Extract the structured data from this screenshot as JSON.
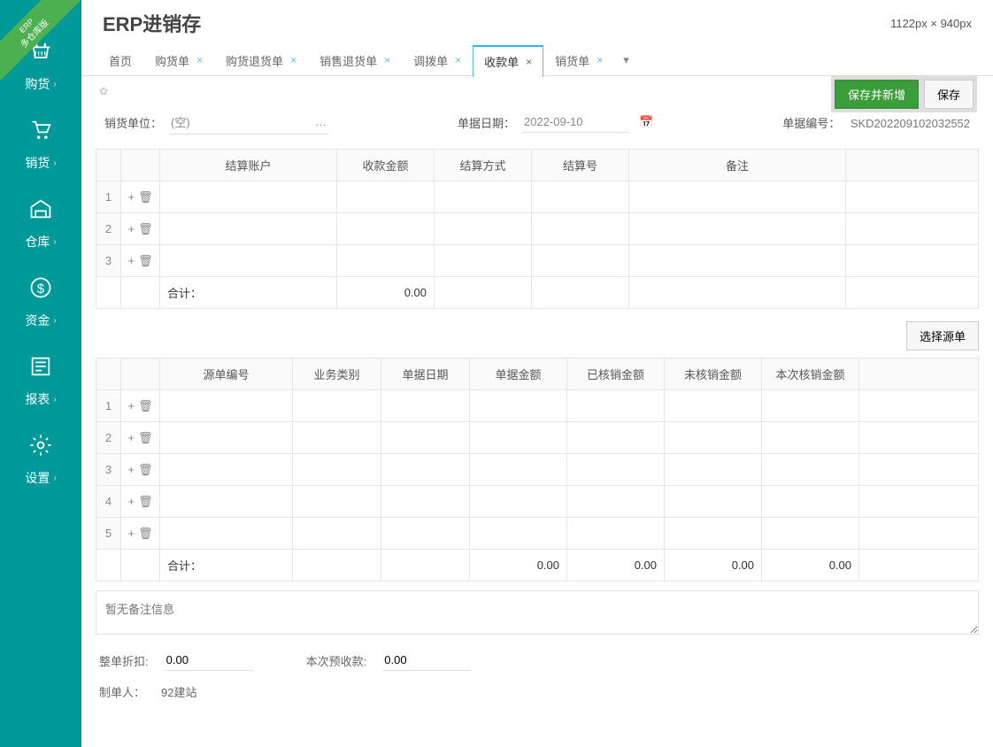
{
  "ribbon": {
    "line1": "ERP",
    "line2": "多仓库版"
  },
  "header": {
    "title": "ERP进销存",
    "dimensions": "1122px × 940px"
  },
  "sidebar": {
    "items": [
      {
        "label": "购货",
        "icon": "basket"
      },
      {
        "label": "销货",
        "icon": "cart"
      },
      {
        "label": "仓库",
        "icon": "warehouse"
      },
      {
        "label": "资金",
        "icon": "money"
      },
      {
        "label": "报表",
        "icon": "report"
      },
      {
        "label": "设置",
        "icon": "gear"
      }
    ]
  },
  "tabs": {
    "items": [
      {
        "label": "首页",
        "closable": false
      },
      {
        "label": "购货单",
        "closable": true
      },
      {
        "label": "购货退货单",
        "closable": true
      },
      {
        "label": "销售退货单",
        "closable": true
      },
      {
        "label": "调拨单",
        "closable": true
      },
      {
        "label": "收款单",
        "closable": true,
        "active": true
      },
      {
        "label": "销货单",
        "closable": true
      }
    ]
  },
  "actions": {
    "saveAdd": "保存并新增",
    "save": "保存"
  },
  "form": {
    "unitLabel": "销货单位：",
    "unitValue": "(空)",
    "dateLabel": "单据日期：",
    "dateValue": "2022-09-10",
    "docNoLabel": "单据编号：",
    "docNoValue": "SKD202209102032552"
  },
  "table1": {
    "headers": [
      "结算账户",
      "收款金额",
      "结算方式",
      "结算号",
      "备注"
    ],
    "rows": [
      1,
      2,
      3
    ],
    "totalLabel": "合计：",
    "totalAmount": "0.00"
  },
  "sourceBtn": "选择源单",
  "table2": {
    "headers": [
      "源单编号",
      "业务类别",
      "单据日期",
      "单据金额",
      "已核销金额",
      "未核销金额",
      "本次核销金额"
    ],
    "rows": [
      1,
      2,
      3,
      4,
      5
    ],
    "totalLabel": "合计：",
    "totals": [
      "0.00",
      "0.00",
      "0.00",
      "0.00"
    ]
  },
  "remark": {
    "placeholder": "暂无备注信息"
  },
  "footer": {
    "discountLabel": "整单折扣:",
    "discountValue": "0.00",
    "prepayLabel": "本次预收款:",
    "prepayValue": "0.00",
    "creatorLabel": "制单人：",
    "creatorValue": "92建站"
  }
}
